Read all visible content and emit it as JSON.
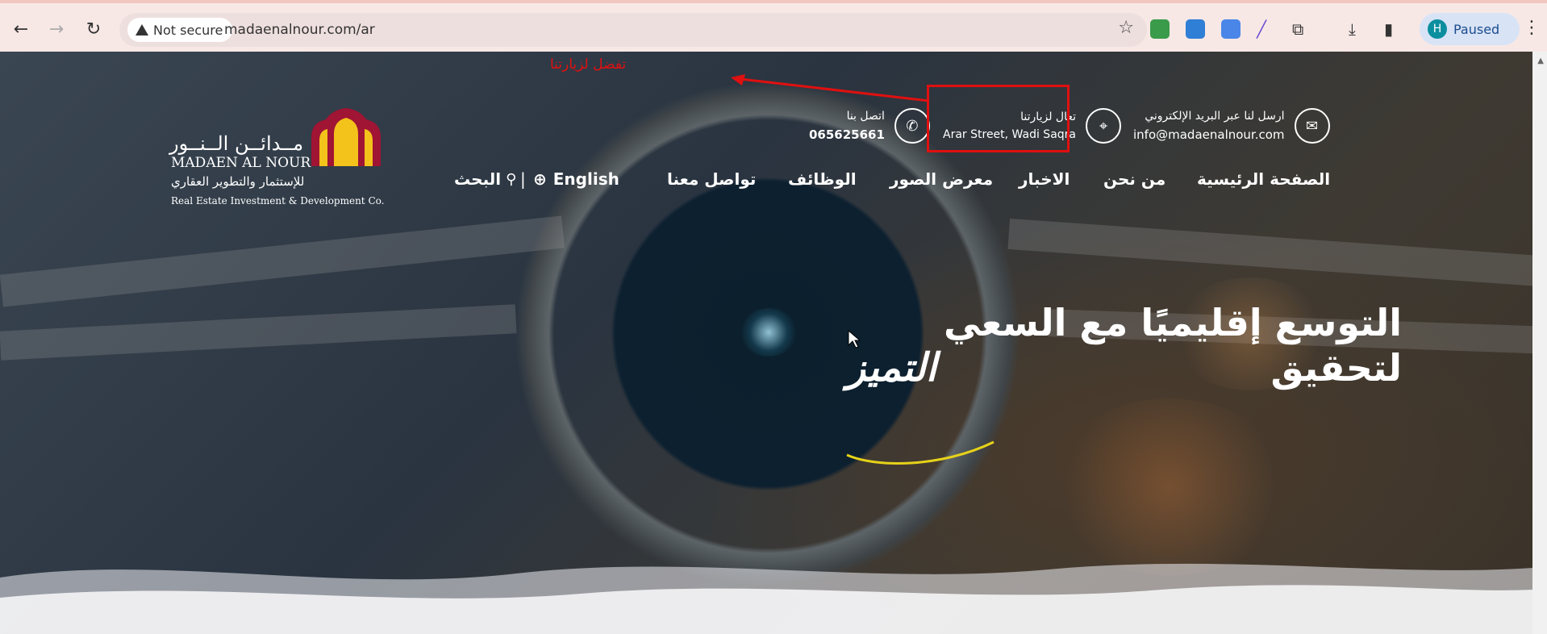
{
  "browser": {
    "security_label": "Not secure",
    "url": "madaenalnour.com/ar",
    "profile_initial": "H",
    "profile_status": "Paused"
  },
  "topbar": {
    "email_label": "ارسل لنا عبر البريد الإلكتروني",
    "email_value": "info@madaenalnour.com",
    "visit_label": "تعال لزيارتنا",
    "visit_value": "Arar Street, Wadi Saqra",
    "call_label": "اتصل بنا",
    "call_value": "065625661"
  },
  "nav": {
    "home": "الصفحة الرئيسية",
    "about": "من نحن",
    "news": "الاخبار",
    "gallery": "معرض الصور",
    "jobs": "الوظائف",
    "contact": "تواصل معنا",
    "language": "English",
    "separator": "|",
    "search": "البحث"
  },
  "logo": {
    "name_ar": "مــدائــن الــنــور",
    "name_en": "MADAEN AL NOUR",
    "tagline_ar": "للإستثمار والتطوير العقاري",
    "tagline_en": "Real Estate Investment & Development Co."
  },
  "hero": {
    "title": "التوسع إقليميًا مع السعي لتحقيق",
    "accent": "التميز",
    "accent_underline_color": "#e6d21a"
  },
  "annotation": {
    "text": "تفضل لزيارتنا",
    "color": "#e01010"
  },
  "icons": {
    "email": "mail-icon",
    "visit": "map-icon",
    "call": "phone-icon",
    "language": "globe-icon",
    "search": "search-icon"
  }
}
